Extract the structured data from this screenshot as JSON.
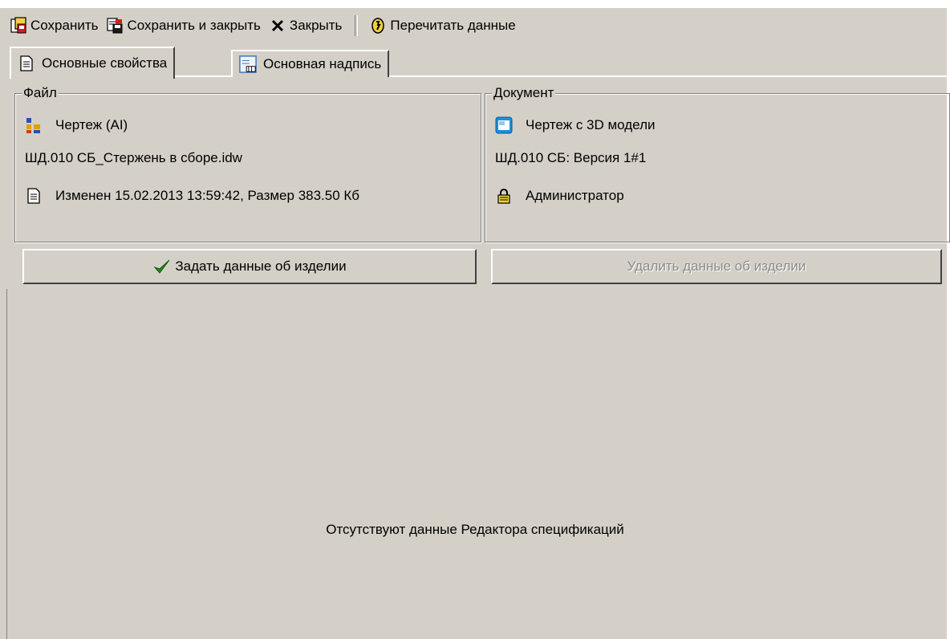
{
  "toolbar": {
    "save": "Сохранить",
    "save_close": "Сохранить и закрыть",
    "close": "Закрыть",
    "reload": "Перечитать данные"
  },
  "tabs": [
    {
      "label": "Основные свойства",
      "active": true
    },
    {
      "label": "Основная надпись",
      "active": false
    }
  ],
  "file_group": {
    "legend": "Файл",
    "type": "Чертеж (AI)",
    "filename": "ШД.010 СБ_Стержень в сборе.idw",
    "modified": "Изменен 15.02.2013 13:59:42, Размер 383.50 Кб"
  },
  "document_group": {
    "legend": "Документ",
    "type": "Чертеж с 3D модели",
    "designation": "ШД.010 СБ: Версия 1#1",
    "owner": "Администратор"
  },
  "actions": {
    "set_product": "Задать данные об изделии",
    "delete_product": "Удалить данные об изделии"
  },
  "empty_message": "Отсутствуют данные Редактора спецификаций",
  "icons": {
    "save": "save-icon",
    "save_close": "save-close-icon",
    "close": "close-icon",
    "reload": "reload-icon",
    "document_tab": "document-icon",
    "stamp_tab": "stamp-icon",
    "drawing": "drawing-icon",
    "file": "file-icon",
    "model_drawing": "model-drawing-icon",
    "lock": "lock-icon",
    "check": "check-icon"
  },
  "colors": {
    "window": "#d4d0c8",
    "disabled_text": "#8a8a8a",
    "check_green": "#1a8a1a"
  }
}
